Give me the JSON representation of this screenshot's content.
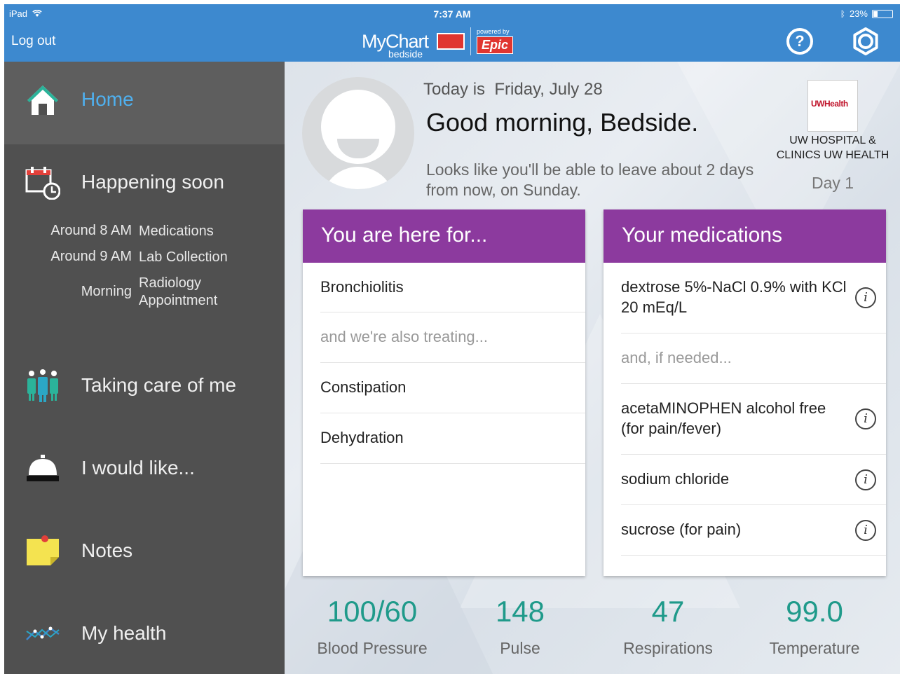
{
  "status_bar": {
    "device": "iPad",
    "time": "7:37 AM",
    "battery": "23%",
    "battery_level": 0.23
  },
  "nav_bar": {
    "logout_label": "Log out",
    "brand_mychart": "MyChart",
    "brand_bedside": "bedside",
    "brand_powered": "powered by",
    "brand_epic": "Epic",
    "help_label": "?"
  },
  "sidebar": {
    "home": "Home",
    "happening_soon": "Happening soon",
    "soon_items": [
      {
        "time": "Around 8 AM",
        "what": "Medications"
      },
      {
        "time": "Around 9 AM",
        "what": "Lab Collection"
      },
      {
        "time": "Morning",
        "what": "Radiology Appointment"
      }
    ],
    "taking_care": "Taking care of me",
    "would_like": "I would like...",
    "notes": "Notes",
    "my_health": "My health"
  },
  "header": {
    "today_prefix": "Today is",
    "today_date": "Friday, July 28",
    "greeting": "Good morning, Bedside.",
    "leave_message": "Looks like you'll be able to leave about 2 days from now, on Sunday.",
    "hospital_logo": "UWHealth",
    "hospital_name": "UW HOSPITAL & CLINICS UW HEALTH",
    "day": "Day 1"
  },
  "here_for": {
    "title": "You are here for...",
    "primary": "Bronchiolitis",
    "also_label": "and we're also treating...",
    "others": [
      "Constipation",
      "Dehydration"
    ]
  },
  "medications": {
    "title": "Your medications",
    "primary": "dextrose 5%-NaCl 0.9% with KCl 20 mEq/L",
    "if_needed_label": "and, if needed...",
    "prn": [
      "acetaMINOPHEN alcohol free (for pain/fever)",
      "sodium chloride",
      "sucrose (for pain)"
    ],
    "info_glyph": "i"
  },
  "vitals": [
    {
      "value": "100/60",
      "label": "Blood Pressure"
    },
    {
      "value": "148",
      "label": "Pulse"
    },
    {
      "value": "47",
      "label": "Respirations"
    },
    {
      "value": "99.0",
      "label": "Temperature"
    }
  ],
  "colors": {
    "nav_blue": "#3d89cf",
    "sidebar": "#505050",
    "card_header": "#8c3a9e",
    "vital_teal": "#1f9a8a",
    "home_active": "#4fb0ef"
  }
}
